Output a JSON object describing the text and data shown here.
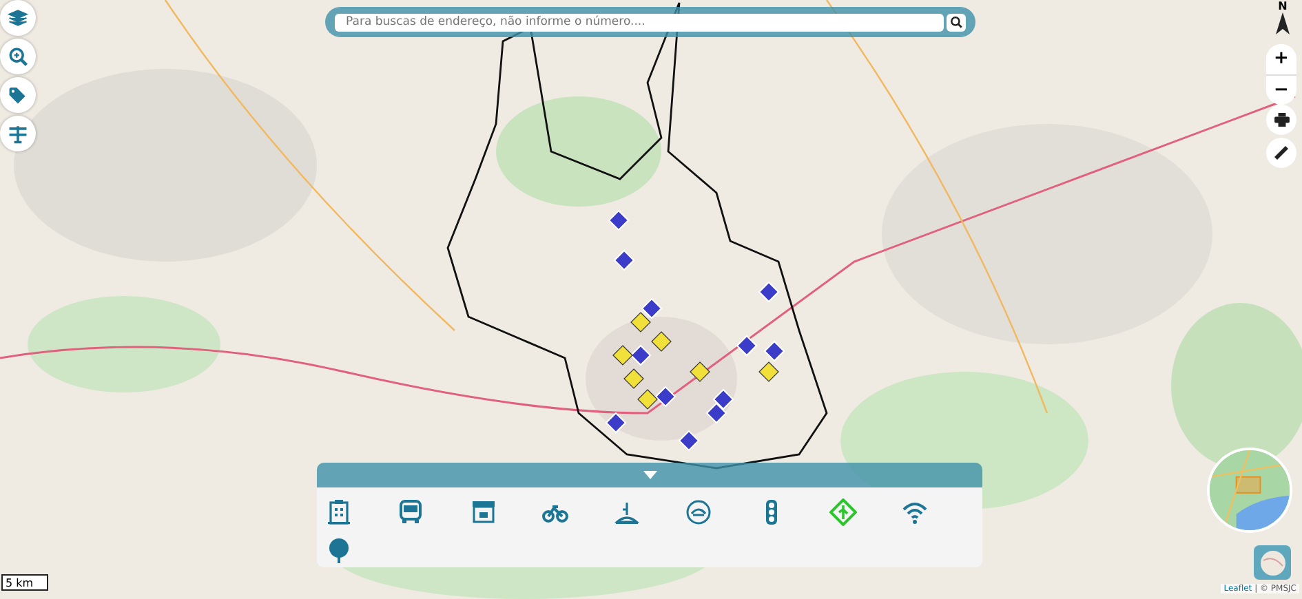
{
  "search": {
    "placeholder": "Para buscas de endereço, não informe o número...."
  },
  "compass": {
    "label": "N"
  },
  "zoom": {
    "in": "+",
    "out": "−"
  },
  "bottom_panel": {
    "expanded": true,
    "categories": [
      {
        "kind": "building"
      },
      {
        "kind": "bus"
      },
      {
        "kind": "market"
      },
      {
        "kind": "bicycle"
      },
      {
        "kind": "monument"
      },
      {
        "kind": "charging"
      },
      {
        "kind": "traffic-light"
      },
      {
        "kind": "pedestrian-sign"
      },
      {
        "kind": "wifi"
      },
      {
        "kind": "tree"
      }
    ]
  },
  "scale": "5 km",
  "attribution": {
    "link": "Leaflet",
    "text": "| © PMSJC"
  }
}
